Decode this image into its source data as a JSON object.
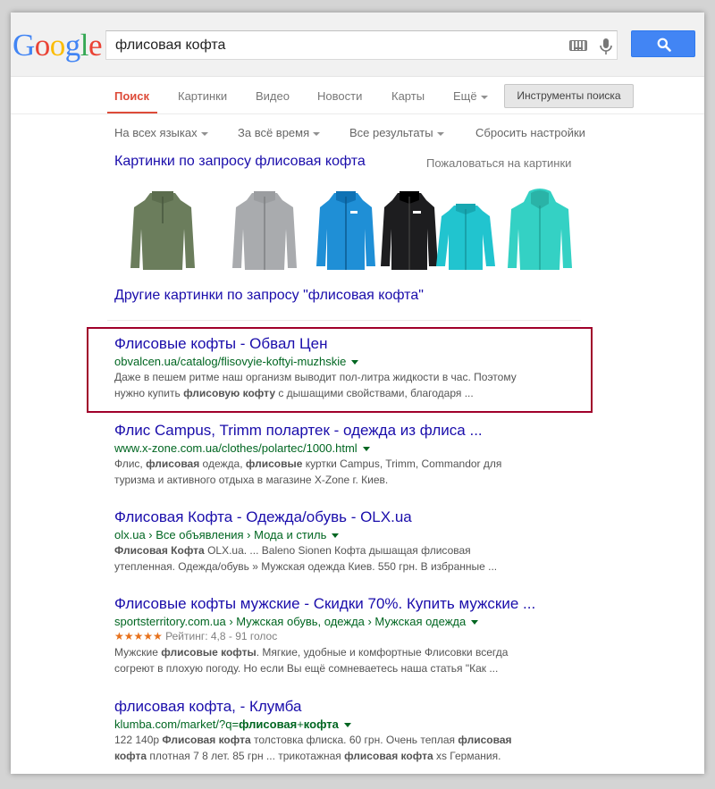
{
  "logo": {
    "letters": [
      "G",
      "o",
      "o",
      "g",
      "l",
      "e"
    ],
    "colors": [
      "#4285f4",
      "#ea4335",
      "#fbbc05",
      "#4285f4",
      "#34a853",
      "#ea4335"
    ]
  },
  "search": {
    "query": "флисовая кофта"
  },
  "tabs": [
    {
      "label": "Поиск",
      "active": true
    },
    {
      "label": "Картинки"
    },
    {
      "label": "Видео"
    },
    {
      "label": "Новости"
    },
    {
      "label": "Карты"
    },
    {
      "label": "Ещё"
    }
  ],
  "tools_label": "Инструменты поиска",
  "filters": [
    "На всех языках",
    "За всё время",
    "Все результаты",
    "Сбросить настройки"
  ],
  "images": {
    "heading": "Картинки по запросу флисовая кофта",
    "report": "Пожаловаться на картинки",
    "more": "Другие картинки по запросу \"флисовая кофта\"",
    "thumbs": [
      {
        "name": "olive-fleece-jacket",
        "color": "#6b7d5c"
      },
      {
        "name": "gray-fleece-jacket",
        "color": "#a9abae"
      },
      {
        "name": "blue-fleece-jacket",
        "color": "#1f8fd6"
      },
      {
        "name": "black-fleece-jacket",
        "color": "#1d1d1f"
      },
      {
        "name": "turquoise-fleece-jacket",
        "color": "#21c4cf"
      },
      {
        "name": "mint-fleece-hoodie",
        "color": "#34d1c4"
      }
    ]
  },
  "results": [
    {
      "title": "Флисовые кофты - Обвал Цен",
      "url": "obvalcen.ua/catalog/flisovyie-koftyi-muzhskie",
      "snippet": [
        [
          {
            "t": "Даже в пешем ритме наш организм выводит пол-литра жидкости в час. Поэтому"
          }
        ],
        [
          {
            "t": "нужно купить "
          },
          {
            "t": "флисовую кофту",
            "b": true
          },
          {
            "t": " с дышащими свойствами, благодаря ..."
          }
        ]
      ]
    },
    {
      "title": "Флис Campus, Trimm полартек - одежда из флиса ...",
      "url": "www.x-zone.com.ua/clothes/polartec/1000.html",
      "snippet": [
        [
          {
            "t": "Флис, "
          },
          {
            "t": "флисовая",
            "b": true
          },
          {
            "t": " одежда, "
          },
          {
            "t": "флисовые",
            "b": true
          },
          {
            "t": " куртки Campus, Trimm, Commandor для"
          }
        ],
        [
          {
            "t": "туризма и активного отдыха в магазине X-Zone г. Киев."
          }
        ]
      ]
    },
    {
      "title": "Флисовая Кофта - Одежда/обувь - OLX.ua",
      "url": "olx.ua › Все объявления › Мода и стиль",
      "snippet": [
        [
          {
            "t": "Флисовая Кофта",
            "b": true
          },
          {
            "t": " OLX.ua. ... Baleno Sionen Кофта дышащая флисовая"
          }
        ],
        [
          {
            "t": "утепленная. Одежда/обувь » Мужская одежда Киев. 550 грн. В избранные ..."
          }
        ]
      ]
    },
    {
      "title": "Флисовые кофты мужские - Скидки 70%. Купить мужские ...",
      "url": "sportsterritory.com.ua › Мужская обувь, одежда › Мужская одежда",
      "rating": {
        "stars": "★★★★★",
        "text": "Рейтинг: 4,8 - 91 голос",
        "value": 4.8
      },
      "snippet": [
        [
          {
            "t": "Мужские "
          },
          {
            "t": "флисовые кофты",
            "b": true
          },
          {
            "t": ". Мягкие, удобные и комфортные Флисовки всегда"
          }
        ],
        [
          {
            "t": "согреют в плохую погоду. Но если Вы ещё сомневаетесь наша статья \"Как ..."
          }
        ]
      ]
    },
    {
      "title": "флисовая кофта, - Клумба",
      "url_parts": [
        {
          "t": "klumba.com/market/?q="
        },
        {
          "t": "флисовая",
          "b": true
        },
        {
          "t": "+"
        },
        {
          "t": "кофта",
          "b": true
        }
      ],
      "snippet": [
        [
          {
            "t": "122 140р "
          },
          {
            "t": "Флисовая кофта",
            "b": true
          },
          {
            "t": " толстовка флиска. 60 грн. Очень теплая "
          },
          {
            "t": "флисовая",
            "b": true
          }
        ],
        [
          {
            "t": "кофта",
            "b": true
          },
          {
            "t": " плотная 7 8 лет. 85 грн ... трикотажная "
          },
          {
            "t": "флисовая кофта",
            "b": true
          },
          {
            "t": " xs Германия."
          }
        ]
      ]
    }
  ]
}
